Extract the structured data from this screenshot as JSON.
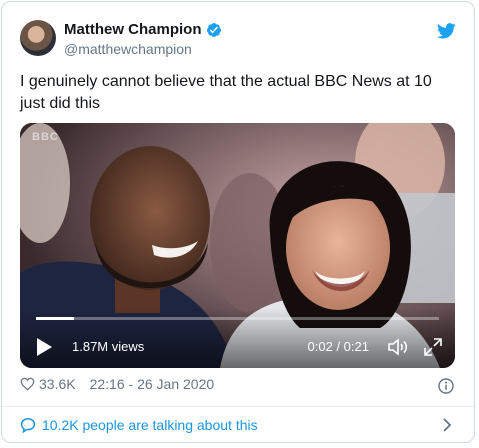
{
  "author": {
    "display_name": "Matthew Champion",
    "handle": "@matthewchampion",
    "verified": true
  },
  "tweet": {
    "text": "I genuinely cannot believe that the actual BBC News at 10 just did this"
  },
  "video": {
    "views": "1.87M views",
    "time": "0:02 / 0:21",
    "progress": 0.095
  },
  "meta": {
    "likes": "33.6K",
    "timestamp": "22:16 - 26 Jan 2020"
  },
  "conversation": {
    "label": "10.2K people are talking about this"
  },
  "colors": {
    "twitter_blue": "#1da1f2",
    "link_blue": "#1b95e0",
    "muted_text": "#657786"
  },
  "icons": [
    "verified-badge-icon",
    "twitter-bird-icon",
    "play-icon",
    "volume-icon",
    "fullscreen-icon",
    "heart-icon",
    "info-icon",
    "speech-bubble-icon",
    "chevron-right-icon"
  ]
}
